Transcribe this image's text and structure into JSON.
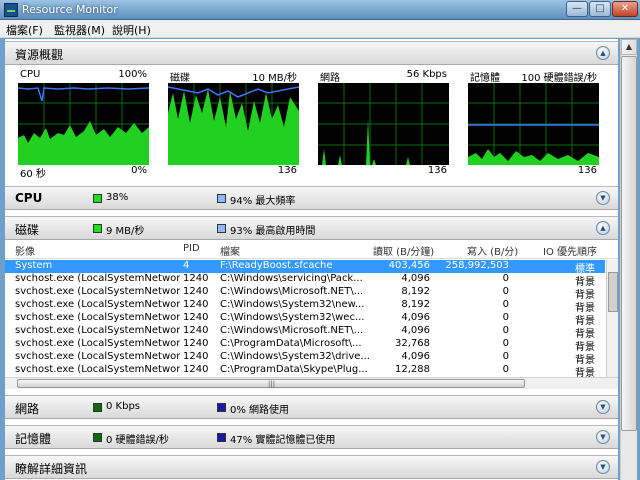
{
  "window": {
    "title": "Resource Monitor"
  },
  "window_controls": {
    "minimize": "—",
    "maximize": "□",
    "close": "✕"
  },
  "menu": [
    "檔案(F)",
    "監視器(M)",
    "說明(H)"
  ],
  "overview": {
    "title": "資源概觀",
    "graphs": [
      {
        "label": "CPU",
        "top_value": "100%",
        "bottom_left": "60 秒",
        "bottom_right": "0%"
      },
      {
        "label": "磁碟",
        "top_value": "10 MB/秒",
        "bottom_left": "",
        "bottom_right": "136"
      },
      {
        "label": "網路",
        "top_value": "56 Kbps",
        "bottom_left": "",
        "bottom_right": "136"
      },
      {
        "label": "記憶體",
        "top_value": "100 硬體錯誤/秒",
        "bottom_left": "",
        "bottom_right": "136"
      }
    ]
  },
  "sections": {
    "cpu": {
      "title": "CPU",
      "stat1": "38%",
      "stat2": "94% 最大頻率"
    },
    "disk": {
      "title": "磁碟",
      "stat1": "9 MB/秒",
      "stat2": "93% 最高啟用時間"
    },
    "network": {
      "title": "網路",
      "stat1": "0 Kbps",
      "stat2": "0% 網路使用"
    },
    "memory": {
      "title": "記憶體",
      "stat1": "0 硬體錯誤/秒",
      "stat2": "47% 實體記憶體已使用"
    },
    "learn_more": {
      "title": "瞭解詳細資訊"
    }
  },
  "colors": {
    "swatch_green": "#1fe01f",
    "swatch_dark_green": "#0d6b0d",
    "swatch_blue": "#8fb8ff",
    "swatch_dark_blue": "#1a1aa8",
    "selection": "#3399ff"
  },
  "disk_table": {
    "columns": [
      "影像",
      "PID",
      "檔案",
      "讀取 (B/分鐘)",
      "寫入 (B/分)",
      "IO 優先順序"
    ],
    "rows": [
      {
        "image": "System",
        "pid": "4",
        "file": "F:\\ReadyBoost.sfcache",
        "read": "403,456",
        "write": "258,992,503",
        "priority": "標準",
        "selected": true
      },
      {
        "image": "svchost.exe (LocalSystemNetworkRest...",
        "pid": "1240",
        "file": "C:\\Windows\\servicing\\Pack...",
        "read": "4,096",
        "write": "0",
        "priority": "背景"
      },
      {
        "image": "svchost.exe (LocalSystemNetworkRest...",
        "pid": "1240",
        "file": "C:\\Windows\\Microsoft.NET\\...",
        "read": "8,192",
        "write": "0",
        "priority": "背景"
      },
      {
        "image": "svchost.exe (LocalSystemNetworkRest...",
        "pid": "1240",
        "file": "C:\\Windows\\System32\\new...",
        "read": "8,192",
        "write": "0",
        "priority": "背景"
      },
      {
        "image": "svchost.exe (LocalSystemNetworkRest...",
        "pid": "1240",
        "file": "C:\\Windows\\System32\\wec...",
        "read": "4,096",
        "write": "0",
        "priority": "背景"
      },
      {
        "image": "svchost.exe (LocalSystemNetworkRest...",
        "pid": "1240",
        "file": "C:\\Windows\\Microsoft.NET\\...",
        "read": "4,096",
        "write": "0",
        "priority": "背景"
      },
      {
        "image": "svchost.exe (LocalSystemNetworkRest...",
        "pid": "1240",
        "file": "C:\\ProgramData\\Microsoft\\...",
        "read": "32,768",
        "write": "0",
        "priority": "背景"
      },
      {
        "image": "svchost.exe (LocalSystemNetworkRest...",
        "pid": "1240",
        "file": "C:\\Windows\\System32\\drive...",
        "read": "4,096",
        "write": "0",
        "priority": "背景"
      },
      {
        "image": "svchost.exe (LocalSystemNetworkRest...",
        "pid": "1240",
        "file": "C:\\ProgramData\\Skype\\Plug...",
        "read": "12,288",
        "write": "0",
        "priority": "背景"
      }
    ]
  }
}
